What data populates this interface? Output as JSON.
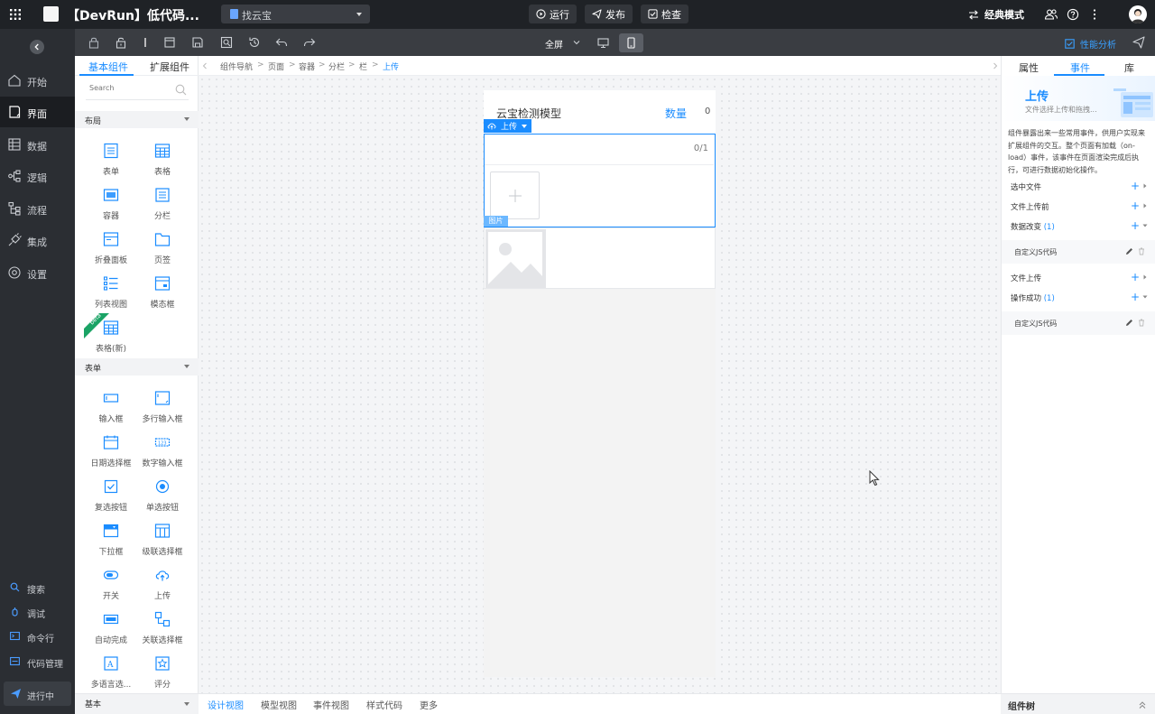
{
  "topbar": {
    "title": "【DevRun】低代码...",
    "page_select": "找云宝",
    "run": "运行",
    "publish": "发布",
    "check": "检查",
    "mode": "经典模式"
  },
  "leftnav": {
    "items": [
      {
        "label": "开始",
        "icon": "home-icon"
      },
      {
        "label": "界面",
        "icon": "page-icon"
      },
      {
        "label": "数据",
        "icon": "table-icon"
      },
      {
        "label": "逻辑",
        "icon": "logic-icon"
      },
      {
        "label": "流程",
        "icon": "flow-icon"
      },
      {
        "label": "集成",
        "icon": "plug-icon"
      },
      {
        "label": "设置",
        "icon": "gear-icon"
      }
    ],
    "tools": [
      {
        "label": "搜索",
        "icon": "search-icon"
      },
      {
        "label": "调试",
        "icon": "bug-icon"
      },
      {
        "label": "命令行",
        "icon": "terminal-icon"
      },
      {
        "label": "代码管理",
        "icon": "git-icon"
      }
    ],
    "running": "进行中"
  },
  "toolbar": {
    "fullscreen": "全屏",
    "perf": "性能分析"
  },
  "components": {
    "tabs": [
      "基本组件",
      "扩展组件"
    ],
    "search_placeholder": "Search",
    "layout_section": "布局",
    "layout_items": [
      "表单",
      "表格",
      "容器",
      "分栏",
      "折叠面板",
      "页签",
      "列表视图",
      "模态框",
      "表格(新)"
    ],
    "beta": "beta",
    "form_section": "表单",
    "form_items": [
      "输入框",
      "多行输入框",
      "日期选择框",
      "数字输入框",
      "复选按钮",
      "单选按钮",
      "下拉框",
      "级联选择框",
      "开关",
      "上传",
      "自动完成",
      "关联选择框",
      "多语言选...",
      "评分"
    ],
    "basic_section": "基本"
  },
  "breadcrumb": [
    "组件导航",
    "页面",
    "容器",
    "分栏",
    "栏",
    "上传"
  ],
  "canvas": {
    "model_title": "云宝检测模型",
    "qty_label": "数量",
    "qty_value": "0",
    "upload_tag": "上传",
    "file_count": "0/1",
    "img_tag": "图片"
  },
  "bottom_tabs": [
    "设计视图",
    "模型视图",
    "事件视图",
    "样式代码",
    "更多"
  ],
  "right_panel": {
    "tabs": [
      "属性",
      "事件",
      "库"
    ],
    "hero_title": "上传",
    "hero_sub": "文件选择上传和拖拽...",
    "description": "组件暴露出来一些常用事件，供用户实现来扩展组件的交互。整个页面有加载（on-load）事件，该事件在页面渲染完成后执行，可进行数据初始化操作。",
    "events": [
      {
        "label": "选中文件",
        "count": ""
      },
      {
        "label": "文件上传前",
        "count": ""
      },
      {
        "label": "数据改变",
        "count": "(1)"
      },
      {
        "label": "文件上传",
        "count": ""
      },
      {
        "label": "操作成功",
        "count": "(1)"
      }
    ],
    "custom_code": "自定义JS代码",
    "tree": "组件树"
  },
  "colors": {
    "accent": "#1a8cff",
    "dark": "#1f2226",
    "nav": "#2b2e33"
  }
}
